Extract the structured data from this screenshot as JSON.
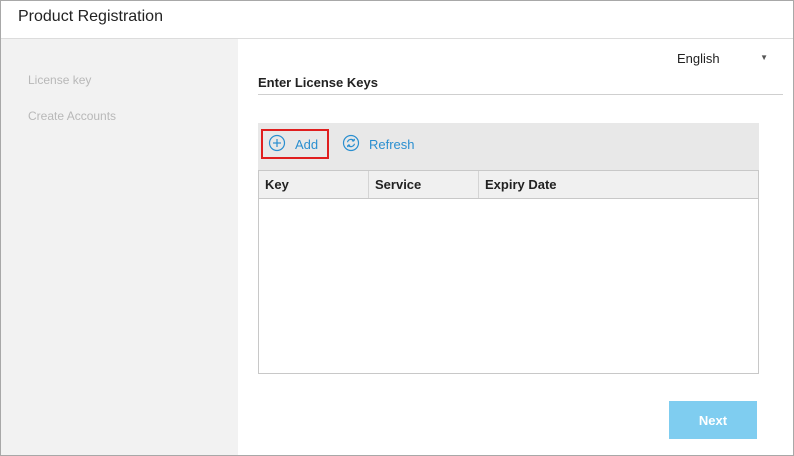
{
  "window": {
    "title": "Product Registration"
  },
  "sidebar": {
    "items": [
      {
        "label": "License key"
      },
      {
        "label": "Create Accounts"
      }
    ]
  },
  "language": {
    "selected": "English",
    "icon": "caret-down-icon"
  },
  "section": {
    "title": "Enter License Keys"
  },
  "toolbar": {
    "add_label": "Add",
    "add_icon": "plus-circle-icon",
    "refresh_label": "Refresh",
    "refresh_icon": "refresh-circle-icon",
    "accent_color": "#2a8fd0",
    "highlight_color": "#e01e1e"
  },
  "table": {
    "columns": [
      "Key",
      "Service",
      "Expiry Date"
    ],
    "rows": []
  },
  "footer": {
    "next_label": "Next",
    "next_color": "#7fcdf0"
  }
}
